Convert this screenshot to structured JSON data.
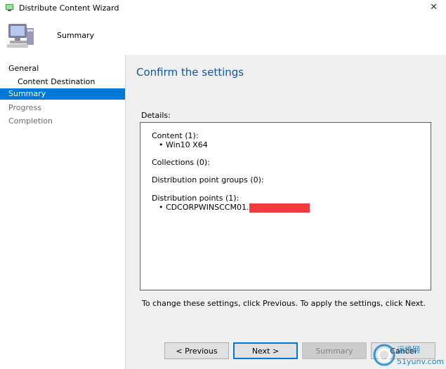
{
  "window": {
    "title": "Distribute Content Wizard",
    "close_glyph": "✕"
  },
  "header": {
    "page_label": "Summary"
  },
  "sidebar": {
    "items": [
      {
        "label": "General"
      },
      {
        "label": "Content Destination"
      },
      {
        "label": "Summary"
      },
      {
        "label": "Progress"
      },
      {
        "label": "Completion"
      }
    ]
  },
  "main": {
    "title": "Confirm the settings",
    "details_label": "Details:",
    "sections": [
      {
        "heading": "Content (1):",
        "items": [
          "Win10 X64"
        ]
      },
      {
        "heading": "Collections (0):",
        "items": []
      },
      {
        "heading": "Distribution point groups (0):",
        "items": []
      },
      {
        "heading": "Distribution points (1):",
        "items": [
          "CDCORPWINSCCM01."
        ]
      }
    ],
    "help_text": "To change these settings, click Previous. To apply the settings, click Next."
  },
  "buttons": {
    "previous": "< Previous",
    "next": "Next >",
    "summary": "Summary",
    "cancel": "Cancel"
  },
  "watermark": {
    "text1": "运维网",
    "text2": "51yunv.com"
  },
  "colors": {
    "accent": "#0078d7",
    "title": "#0a55b4",
    "redaction": "#f23a3f"
  }
}
